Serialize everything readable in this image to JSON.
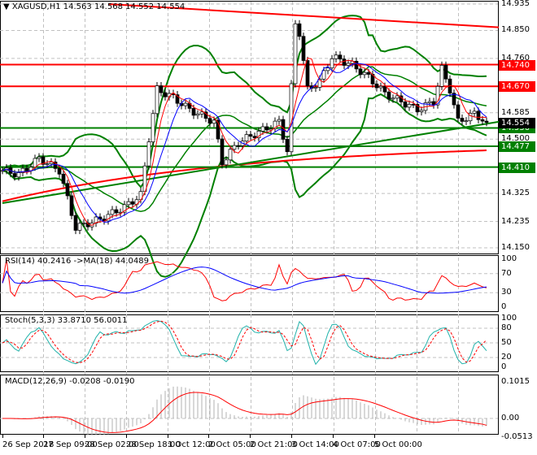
{
  "header": {
    "symbol": "XAGUSD,H1",
    "ohlc": "14.563 14.568 14.552 14.554"
  },
  "indicators": {
    "rsi": "RSI(14) 40.2416  ->MA(18) 44.0489",
    "stoch": "Stoch(5,3,3) 33.8710 56.0011",
    "macd": "MACD(12,26,9) -0.0208 -0.0190"
  },
  "colors": {
    "up": "#008000",
    "red": "#ff0000",
    "blue": "#0000ff",
    "stoch": "#20b2aa",
    "bg": "#ffffff"
  },
  "chart_data": {
    "type": "candlestick",
    "symbol": "XAGUSD",
    "timeframe": "H1",
    "ylim": [
      14.15,
      14.935
    ],
    "price_ticks": [
      "14.935",
      "14.850",
      "14.760",
      "14.585",
      "14.500",
      "14.325",
      "14.235",
      "14.150"
    ],
    "current_price": "14.554",
    "levels": [
      {
        "value": "14.740",
        "color": "#ff0000"
      },
      {
        "value": "14.670",
        "color": "#ff0000"
      },
      {
        "value": "14.536",
        "color": "#008000"
      },
      {
        "value": "14.477",
        "color": "#008000"
      },
      {
        "value": "14.410",
        "color": "#008000"
      }
    ],
    "close_keypoints": [
      [
        0,
        14.399
      ],
      [
        4,
        14.386
      ],
      [
        9,
        14.438
      ],
      [
        14,
        14.399
      ],
      [
        18,
        14.215
      ],
      [
        24,
        14.242
      ],
      [
        30,
        14.281
      ],
      [
        34,
        14.32
      ],
      [
        36,
        14.503
      ],
      [
        38,
        14.66
      ],
      [
        42,
        14.634
      ],
      [
        46,
        14.595
      ],
      [
        52,
        14.556
      ],
      [
        54,
        14.425
      ],
      [
        58,
        14.49
      ],
      [
        64,
        14.529
      ],
      [
        68,
        14.556
      ],
      [
        70,
        14.464
      ],
      [
        72,
        14.87
      ],
      [
        73,
        14.843
      ],
      [
        75,
        14.66
      ],
      [
        78,
        14.686
      ],
      [
        81,
        14.765
      ],
      [
        86,
        14.739
      ],
      [
        90,
        14.699
      ],
      [
        94,
        14.647
      ],
      [
        98,
        14.621
      ],
      [
        102,
        14.595
      ],
      [
        106,
        14.621
      ],
      [
        108,
        14.726
      ],
      [
        110,
        14.66
      ],
      [
        112,
        14.556
      ],
      [
        116,
        14.582
      ],
      [
        119,
        14.554
      ]
    ],
    "trendlines": [
      {
        "color": "#ff0000",
        "from": [
          26,
          14.935
        ],
        "to": [
          122,
          14.86
        ]
      },
      {
        "color": "#008000",
        "from": [
          0,
          14.294
        ],
        "to": [
          122,
          14.556
        ]
      }
    ],
    "time_labels": [
      "26 Sep 2018",
      "27 Sep 09:00",
      "28 Sep 02:00",
      "28 Sep 18:00",
      "1 Oct 12:00",
      "2 Oct 05:00",
      "2 Oct 21:00",
      "3 Oct 14:00",
      "4 Oct 07:00",
      "5 Oct 00:00"
    ],
    "rsi": {
      "ticks": [
        "100",
        "70",
        "30",
        "0"
      ],
      "value": 40.2416,
      "ma": 44.0489
    },
    "stoch": {
      "ticks": [
        "100",
        "80",
        "50",
        "20",
        "0"
      ],
      "k": 33.871,
      "d": 56.0011
    },
    "macd": {
      "ticks": [
        "0.1015",
        "0.00",
        "-0.0513"
      ],
      "main": -0.0208,
      "signal": -0.019
    }
  }
}
